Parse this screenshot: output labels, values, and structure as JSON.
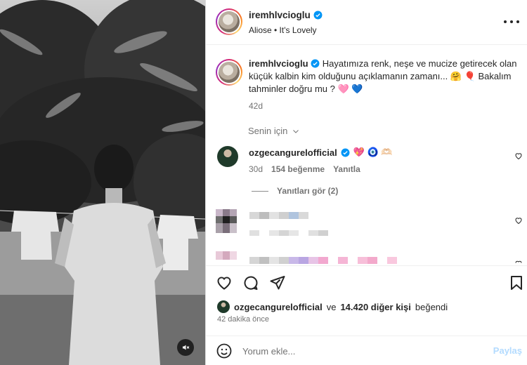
{
  "post": {
    "username": "iremhlvcioglu",
    "audio": "Aliose • It's Lovely",
    "caption_user": "iremhlvcioglu",
    "caption_text": "Hayatımıza renk, neşe ve mucize getirecek olan küçük kalbin kim olduğunu açıklamanın zamanı... 🤗 🎈 Bakalım tahminler doğru mu ? 🩷 💙",
    "caption_time": "42d"
  },
  "comments_filter": "Senin için",
  "comment": {
    "username": "ozgecangurelofficial",
    "emojis": "💖 🧿 🫶🏻",
    "time": "30d",
    "likes": "154 beğenme",
    "reply_label": "Yanıtla",
    "view_replies": "Yanıtları gör (2)"
  },
  "likes": {
    "user": "ozgecangurelofficial",
    "connector": "ve",
    "others": "14.420 diğer kişi",
    "suffix": "beğendi"
  },
  "timestamp": "42 dakika önce",
  "input": {
    "placeholder": "Yorum ekle...",
    "post_label": "Paylaş"
  },
  "icons": {
    "more": "more-horizontal-icon",
    "verified": "verified-badge-icon",
    "chevron": "chevron-down-icon",
    "heart": "heart-icon",
    "comment": "comment-icon",
    "share": "share-icon",
    "save": "bookmark-icon",
    "emoji": "emoji-icon",
    "mute": "volume-off-icon"
  },
  "colors": {
    "verified_blue": "#0095f6",
    "post_disabled": "#b3dbff",
    "secondary_text": "#737373"
  }
}
